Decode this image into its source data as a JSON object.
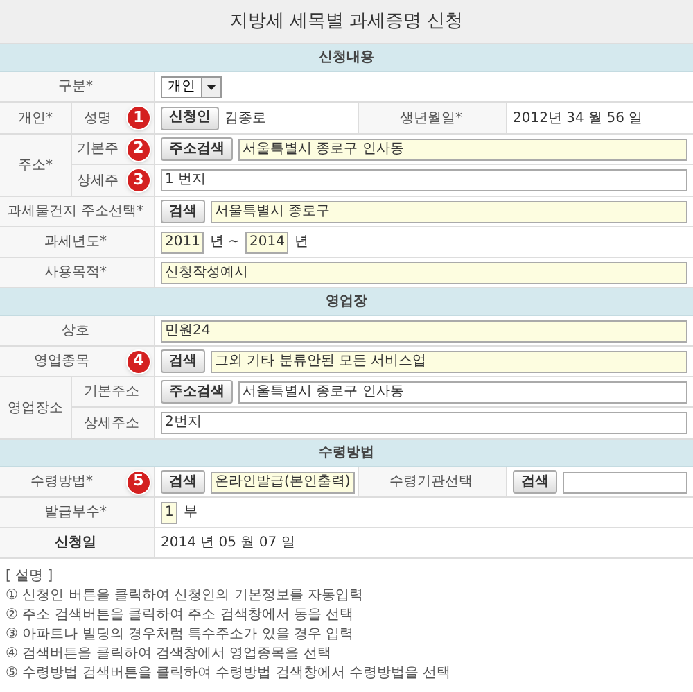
{
  "title": "지방세 세목별 과세증명 신청",
  "sections": [
    {
      "heading": "신청내용",
      "rows": [
        {
          "label": "구분*",
          "items": [
            {
              "kind": "select",
              "text": "개인"
            }
          ]
        },
        {
          "label": "개인*",
          "children": [
            {
              "label": "성명",
              "marker": "1",
              "items": [
                {
                  "kind": "button",
                  "text": "신청인"
                },
                {
                  "kind": "text",
                  "text": "김종로"
                }
              ],
              "extra": {
                "label": "생년월일*",
                "items": [
                  {
                    "kind": "text",
                    "text": "2012년 34 월 56 일"
                  }
                ]
              }
            }
          ]
        },
        {
          "label": "주소*",
          "children": [
            {
              "label": "기본주",
              "marker": "2",
              "items": [
                {
                  "kind": "button",
                  "text": "주소검색"
                },
                {
                  "kind": "field",
                  "text": "서울특별시 종로구 인사동",
                  "highlighted": true
                }
              ]
            },
            {
              "label": "상세주",
              "marker": "3",
              "items": [
                {
                  "kind": "field",
                  "text": "1 번지",
                  "highlighted": false
                }
              ]
            }
          ]
        },
        {
          "label": "과세물건지 주소선택*",
          "items": [
            {
              "kind": "button",
              "text": "검색"
            },
            {
              "kind": "field",
              "text": "서울특별시 종로구",
              "highlighted": true
            }
          ]
        },
        {
          "label": "과세년도*",
          "items": [
            {
              "kind": "box",
              "text": "2011",
              "highlighted": true
            },
            {
              "kind": "text",
              "text": "년 ~"
            },
            {
              "kind": "box",
              "text": "2014",
              "highlighted": true
            },
            {
              "kind": "text",
              "text": "년"
            }
          ]
        },
        {
          "label": "사용목적*",
          "items": [
            {
              "kind": "field",
              "text": "신청작성예시",
              "highlighted": true
            }
          ]
        }
      ]
    },
    {
      "heading": "영업장",
      "rows": [
        {
          "label": "상호",
          "items": [
            {
              "kind": "field",
              "text": "민원24",
              "highlighted": true
            }
          ]
        },
        {
          "label": "영업종목",
          "marker": "4",
          "items": [
            {
              "kind": "button",
              "text": "검색"
            },
            {
              "kind": "field",
              "text": "그외 기타 분류안된 모든 서비스업",
              "highlighted": true
            }
          ]
        },
        {
          "label": "영업장소",
          "children": [
            {
              "label": "기본주소",
              "items": [
                {
                  "kind": "button",
                  "text": "주소검색"
                },
                {
                  "kind": "field",
                  "text": "서울특별시 종로구 인사동",
                  "highlighted": false
                }
              ]
            },
            {
              "label": "상세주소",
              "items": [
                {
                  "kind": "field",
                  "text": "2번지",
                  "highlighted": false
                }
              ]
            }
          ]
        }
      ]
    },
    {
      "heading": "수령방법",
      "rows": [
        {
          "label": "수령방법*",
          "marker": "5",
          "items": [
            {
              "kind": "button",
              "text": "검색"
            },
            {
              "kind": "box",
              "text": "온라인발급(본인출력)",
              "highlighted": true
            }
          ],
          "extra": {
            "label": "수령기관선택",
            "items": [
              {
                "kind": "button",
                "text": "검색"
              },
              {
                "kind": "field",
                "highlighted": false
              }
            ]
          }
        },
        {
          "label": "발급부수*",
          "items": [
            {
              "kind": "box",
              "text": "1",
              "highlighted": true
            },
            {
              "kind": "text",
              "text": "부"
            }
          ]
        },
        {
          "label": "신청일",
          "strong": true,
          "items": [
            {
              "kind": "text",
              "text": "2014 년 05 월 07 일"
            }
          ]
        }
      ]
    }
  ],
  "notes": {
    "heading": "[ 설명 ]",
    "items": [
      "① 신청인 버튼을 클릭하여 신청인의 기본정보를 자동입력",
      "② 주소 검색버튼을 클릭하여 주소 검색창에서 동을 선택",
      "③ 아파트나 빌딩의 경우처럼 특수주소가 있을 경우 입력",
      "④ 검색버튼을 클릭하여 검색창에서 영업종목을 선택",
      "⑤ 수령방법 검색버튼을 클릭하여 수령방법 검색창에서 수령방법을 선택"
    ]
  }
}
